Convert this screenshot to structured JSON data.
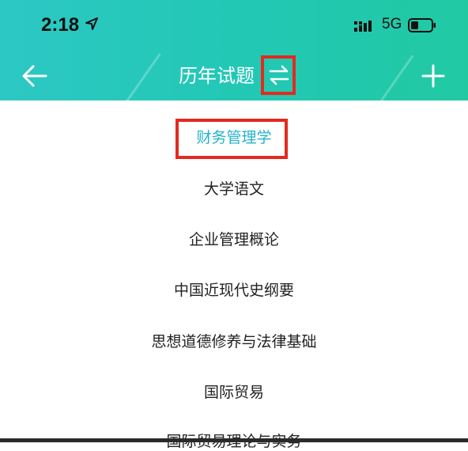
{
  "status_bar": {
    "time": "2:18",
    "network": "5G"
  },
  "nav": {
    "title": "历年试题"
  },
  "subjects": [
    {
      "label": "财务管理学",
      "active": true
    },
    {
      "label": "大学语文",
      "active": false
    },
    {
      "label": "企业管理概论",
      "active": false
    },
    {
      "label": "中国近现代史纲要",
      "active": false
    },
    {
      "label": "思想道德修养与法律基础",
      "active": false
    },
    {
      "label": "国际贸易",
      "active": false
    },
    {
      "label": "国际贸易理论与实务",
      "active": false
    }
  ],
  "colors": {
    "header_start": "#2cc8c4",
    "header_end": "#21c9a3",
    "active_text": "#23b3c9",
    "highlight": "#e32a1f"
  },
  "icons": [
    "back-arrow-icon",
    "switch-arrows-icon",
    "plus-icon",
    "location-arrow-icon",
    "signal-icon",
    "battery-icon"
  ]
}
